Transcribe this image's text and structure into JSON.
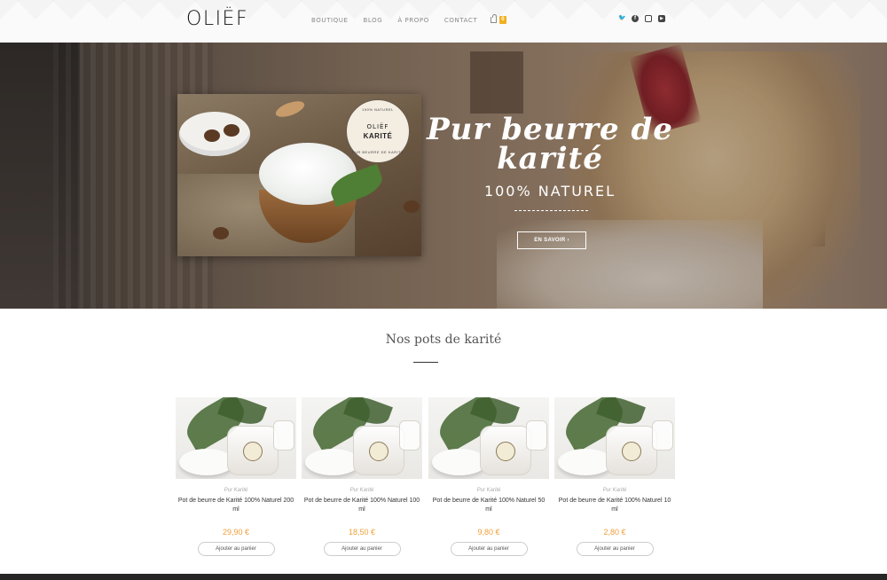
{
  "brand": {
    "logo": "OLIËF"
  },
  "nav": {
    "items": [
      "BOUTIQUE",
      "BLOG",
      "À PROPO",
      "CONTACT"
    ],
    "cart_count": "0"
  },
  "social": [
    "twitter-icon",
    "facebook-icon",
    "instagram-icon",
    "youtube-icon"
  ],
  "hero": {
    "title_line1": "Pur beurre de",
    "title_line2": "karité",
    "subtitle": "100% NATUREL",
    "button": "EN SAVOIR ›",
    "seal": {
      "top": "100% NATUREL",
      "logo": "OLIËF",
      "name": "KARITÉ",
      "bottom": "PUR BEURRE DE KARITÉ"
    }
  },
  "section": {
    "title": "Nos pots de karité"
  },
  "products": [
    {
      "category": "Pur Karité",
      "title": "Pot de beurre de Karité 100% Naturel 200 ml",
      "price": "29,90 €",
      "button": "Ajouter au panier"
    },
    {
      "category": "Pur Karité",
      "title": "Pot de beurre de Karité 100% Naturel 100 ml",
      "price": "18,50 €",
      "button": "Ajouter au panier"
    },
    {
      "category": "Pur Karité",
      "title": "Pot de beurre de Karité 100% Naturel 50 ml",
      "price": "9,80 €",
      "button": "Ajouter au panier"
    },
    {
      "category": "Pur Karité",
      "title": "Pot de beurre de Karité 100% Naturel 10 ml",
      "price": "2,80 €",
      "button": "Ajouter au panier"
    }
  ],
  "colors": {
    "accent": "#f2b01e",
    "price": "#f0a03a",
    "footer": "#262626"
  }
}
